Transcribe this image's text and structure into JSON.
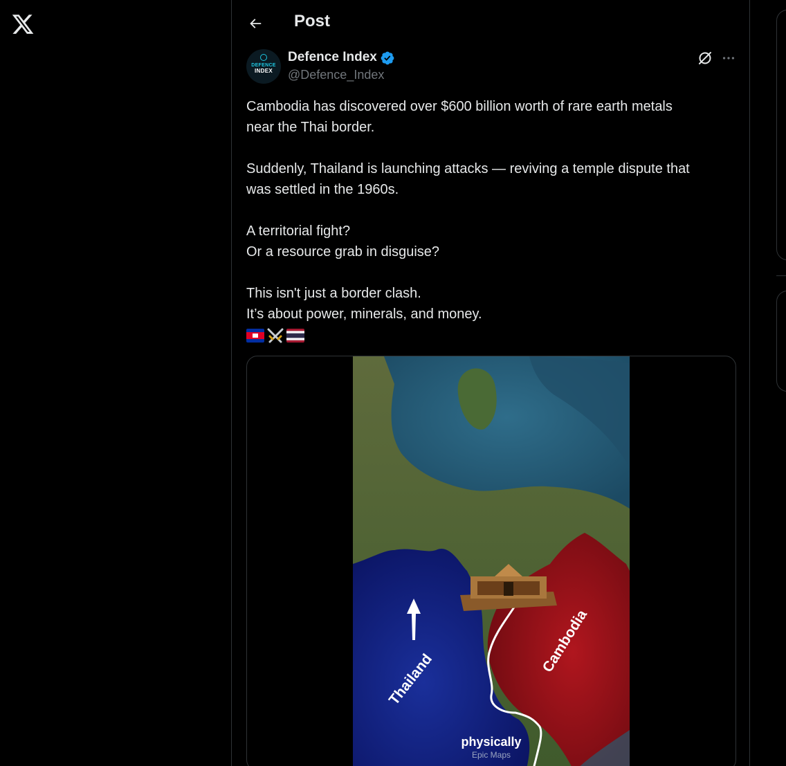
{
  "nav": {
    "logo_icon": "x-logo-icon"
  },
  "header": {
    "back_icon": "arrow-left-icon",
    "title": "Post"
  },
  "author": {
    "avatar_line1": "DEFENCE",
    "avatar_line2": "INDEX",
    "name": "Defence Index",
    "handle": "@Defence_Index",
    "verified_icon": "verified-badge-icon"
  },
  "actions": {
    "grok_icon": "grok-icon",
    "more_icon": "more-horizontal-icon"
  },
  "tweet": {
    "paragraphs": [
      [
        "Cambodia has discovered over $600 billion worth of rare earth metals",
        "near the Thai border."
      ],
      [
        "Suddenly, Thailand is launching attacks — reviving a temple dispute that",
        "was settled in the 1960s."
      ],
      [
        "A territorial fight?",
        "Or a resource grab in disguise?"
      ],
      [
        "This isn't just a border clash.",
        "It’s about power, minerals, and money."
      ]
    ],
    "flags": [
      "🇰🇭",
      "⚔️",
      "🇹🇭"
    ]
  },
  "media": {
    "label_thailand": "Thailand",
    "label_cambodia": "Cambodia",
    "caption": "physically",
    "watermark": "Epic Maps"
  },
  "colors": {
    "background": "#000000",
    "text": "#e7e9ea",
    "secondary": "#71767b",
    "border": "#2f3336",
    "verified": "#1d9bf0"
  }
}
